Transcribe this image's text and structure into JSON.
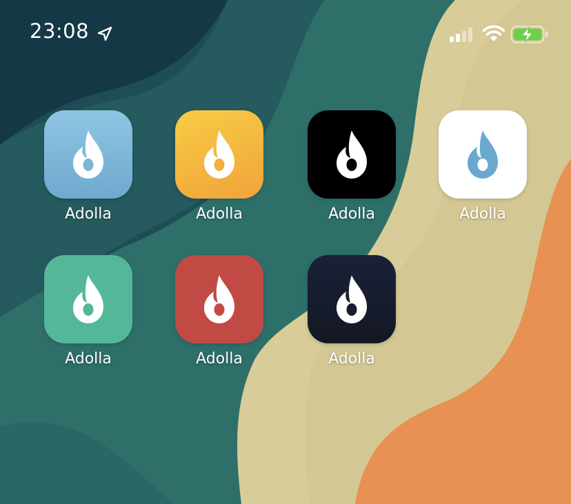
{
  "status_bar": {
    "time": "23:08",
    "location_icon": "location-arrow-icon",
    "signal_icon": "cellular-signal-icon",
    "wifi_icon": "wifi-icon",
    "battery_icon": "battery-charging-icon"
  },
  "apps": [
    {
      "label": "Adolla",
      "icon": "flame-icon",
      "bg": "#7fb7d9",
      "flame": "#ffffff"
    },
    {
      "label": "Adolla",
      "icon": "flame-icon",
      "bg": "#f2b13e",
      "flame": "#ffffff"
    },
    {
      "label": "Adolla",
      "icon": "flame-icon",
      "bg": "#000000",
      "flame": "#ffffff"
    },
    {
      "label": "Adolla",
      "icon": "flame-icon",
      "bg": "#ffffff",
      "flame": "#6aa8d0"
    },
    {
      "label": "Adolla",
      "icon": "flame-icon",
      "bg": "#55b79a",
      "flame": "#ffffff"
    },
    {
      "label": "Adolla",
      "icon": "flame-icon",
      "bg": "#c24a45",
      "flame": "#ffffff"
    },
    {
      "label": "Adolla",
      "icon": "flame-icon",
      "bg": "#161b2e",
      "flame": "#ffffff"
    }
  ],
  "colors": {
    "wallpaper_dark": "#143c47",
    "wallpaper_teal": "#2d6b68",
    "wallpaper_sand": "#d8cc98",
    "wallpaper_orange": "#e79152",
    "battery_green": "#6cd04b"
  }
}
